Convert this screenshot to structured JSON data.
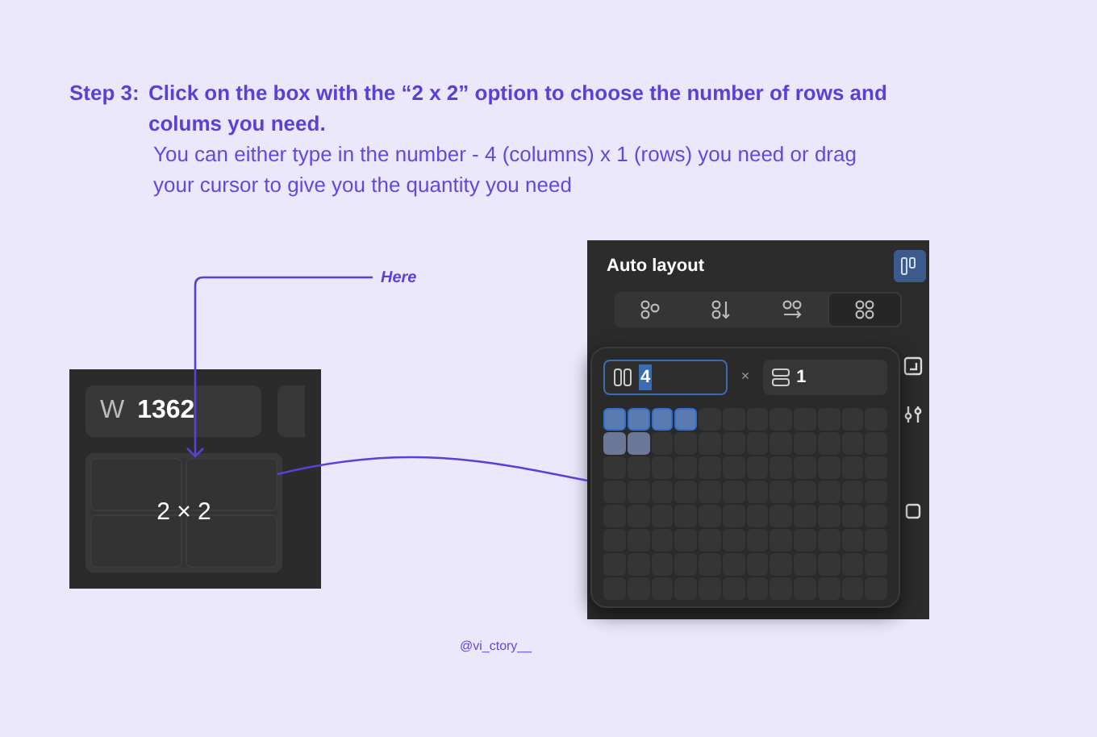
{
  "step_label": "Step 3:",
  "instruction": "Click on the box with the “2 x 2” option to choose the number of rows and colums you need.",
  "detail": "You can either type in the number - 4 (columns) x 1 (rows) you need or drag your cursor to give you the quantity you need",
  "callout": "Here",
  "left_panel": {
    "width_label": "W",
    "width_value": "1362",
    "grid_label": "2 × 2"
  },
  "right_panel": {
    "title": "Auto layout",
    "modes": [
      {
        "selected": false
      },
      {
        "selected": false
      },
      {
        "selected": false
      },
      {
        "selected": true
      }
    ],
    "columns_value": "4",
    "times": "×",
    "rows_value": "1",
    "grid": [
      {
        "cells": [
          {
            "selected": true,
            "hovered": false
          },
          {
            "selected": true,
            "hovered": false
          },
          {
            "selected": true,
            "hovered": false
          },
          {
            "selected": true,
            "hovered": false
          },
          {
            "selected": false,
            "hovered": false
          },
          {
            "selected": false,
            "hovered": false
          },
          {
            "selected": false,
            "hovered": false
          },
          {
            "selected": false,
            "hovered": false
          },
          {
            "selected": false,
            "hovered": false
          },
          {
            "selected": false,
            "hovered": false
          },
          {
            "selected": false,
            "hovered": false
          },
          {
            "selected": false,
            "hovered": false
          }
        ]
      },
      {
        "cells": [
          {
            "selected": false,
            "hovered": true
          },
          {
            "selected": false,
            "hovered": true
          },
          {
            "selected": false,
            "hovered": false
          },
          {
            "selected": false,
            "hovered": false
          },
          {
            "selected": false,
            "hovered": false
          },
          {
            "selected": false,
            "hovered": false
          },
          {
            "selected": false,
            "hovered": false
          },
          {
            "selected": false,
            "hovered": false
          },
          {
            "selected": false,
            "hovered": false
          },
          {
            "selected": false,
            "hovered": false
          },
          {
            "selected": false,
            "hovered": false
          },
          {
            "selected": false,
            "hovered": false
          }
        ]
      },
      {
        "cells": [
          {
            "selected": false,
            "hovered": false
          },
          {
            "selected": false,
            "hovered": false
          },
          {
            "selected": false,
            "hovered": false
          },
          {
            "selected": false,
            "hovered": false
          },
          {
            "selected": false,
            "hovered": false
          },
          {
            "selected": false,
            "hovered": false
          },
          {
            "selected": false,
            "hovered": false
          },
          {
            "selected": false,
            "hovered": false
          },
          {
            "selected": false,
            "hovered": false
          },
          {
            "selected": false,
            "hovered": false
          },
          {
            "selected": false,
            "hovered": false
          },
          {
            "selected": false,
            "hovered": false
          }
        ]
      },
      {
        "cells": [
          {
            "selected": false,
            "hovered": false
          },
          {
            "selected": false,
            "hovered": false
          },
          {
            "selected": false,
            "hovered": false
          },
          {
            "selected": false,
            "hovered": false
          },
          {
            "selected": false,
            "hovered": false
          },
          {
            "selected": false,
            "hovered": false
          },
          {
            "selected": false,
            "hovered": false
          },
          {
            "selected": false,
            "hovered": false
          },
          {
            "selected": false,
            "hovered": false
          },
          {
            "selected": false,
            "hovered": false
          },
          {
            "selected": false,
            "hovered": false
          },
          {
            "selected": false,
            "hovered": false
          }
        ]
      },
      {
        "cells": [
          {
            "selected": false,
            "hovered": false
          },
          {
            "selected": false,
            "hovered": false
          },
          {
            "selected": false,
            "hovered": false
          },
          {
            "selected": false,
            "hovered": false
          },
          {
            "selected": false,
            "hovered": false
          },
          {
            "selected": false,
            "hovered": false
          },
          {
            "selected": false,
            "hovered": false
          },
          {
            "selected": false,
            "hovered": false
          },
          {
            "selected": false,
            "hovered": false
          },
          {
            "selected": false,
            "hovered": false
          },
          {
            "selected": false,
            "hovered": false
          },
          {
            "selected": false,
            "hovered": false
          }
        ]
      },
      {
        "cells": [
          {
            "selected": false,
            "hovered": false
          },
          {
            "selected": false,
            "hovered": false
          },
          {
            "selected": false,
            "hovered": false
          },
          {
            "selected": false,
            "hovered": false
          },
          {
            "selected": false,
            "hovered": false
          },
          {
            "selected": false,
            "hovered": false
          },
          {
            "selected": false,
            "hovered": false
          },
          {
            "selected": false,
            "hovered": false
          },
          {
            "selected": false,
            "hovered": false
          },
          {
            "selected": false,
            "hovered": false
          },
          {
            "selected": false,
            "hovered": false
          },
          {
            "selected": false,
            "hovered": false
          }
        ]
      },
      {
        "cells": [
          {
            "selected": false,
            "hovered": false
          },
          {
            "selected": false,
            "hovered": false
          },
          {
            "selected": false,
            "hovered": false
          },
          {
            "selected": false,
            "hovered": false
          },
          {
            "selected": false,
            "hovered": false
          },
          {
            "selected": false,
            "hovered": false
          },
          {
            "selected": false,
            "hovered": false
          },
          {
            "selected": false,
            "hovered": false
          },
          {
            "selected": false,
            "hovered": false
          },
          {
            "selected": false,
            "hovered": false
          },
          {
            "selected": false,
            "hovered": false
          },
          {
            "selected": false,
            "hovered": false
          }
        ]
      },
      {
        "cells": [
          {
            "selected": false,
            "hovered": false
          },
          {
            "selected": false,
            "hovered": false
          },
          {
            "selected": false,
            "hovered": false
          },
          {
            "selected": false,
            "hovered": false
          },
          {
            "selected": false,
            "hovered": false
          },
          {
            "selected": false,
            "hovered": false
          },
          {
            "selected": false,
            "hovered": false
          },
          {
            "selected": false,
            "hovered": false
          },
          {
            "selected": false,
            "hovered": false
          },
          {
            "selected": false,
            "hovered": false
          },
          {
            "selected": false,
            "hovered": false
          },
          {
            "selected": false,
            "hovered": false
          }
        ]
      }
    ]
  },
  "credit": "@vi_ctory__"
}
